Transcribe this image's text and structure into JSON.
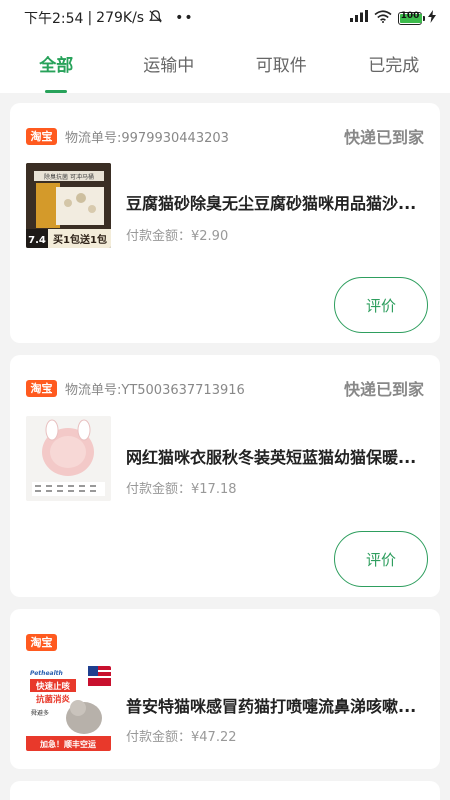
{
  "status_bar": {
    "time": "下午2:54",
    "speed": "279K/s",
    "battery": "100",
    "battery_level": 1.0
  },
  "tabs": [
    {
      "label": "全部",
      "active": true
    },
    {
      "label": "运输中",
      "active": false
    },
    {
      "label": "可取件",
      "active": false
    },
    {
      "label": "已完成",
      "active": false
    }
  ],
  "orders": [
    {
      "shop_logo": "淘宝",
      "tracking": "物流单号:9979930443203",
      "status": "快递已到家",
      "title": "豆腐猫砂除臭无尘豆腐砂猫咪用品猫沙...",
      "price": "付款金额：¥2.90",
      "action": "评价",
      "thumb": {
        "banner": "买1包送1包",
        "badge": "7.4",
        "top": "除臭抗菌 可冲马桶"
      }
    },
    {
      "shop_logo": "淘宝",
      "tracking": "物流单号:YT5003637713916",
      "status": "快递已到家",
      "title": "网红猫咪衣服秋冬装英短蓝猫幼猫保暖...",
      "price": "付款金额：¥17.18",
      "action": "评价"
    },
    {
      "shop_logo": "淘宝",
      "tracking": "",
      "status": "",
      "title": "普安特猫咪感冒药猫打喷嚏流鼻涕咳嗽...",
      "price": "付款金额：¥47.22",
      "action": "",
      "thumb": {
        "brand": "Pethealth",
        "line1": "快速止咳",
        "line2": "抗菌消炎",
        "line3": "舜避多",
        "banner": "加急！顺丰空运"
      }
    }
  ]
}
